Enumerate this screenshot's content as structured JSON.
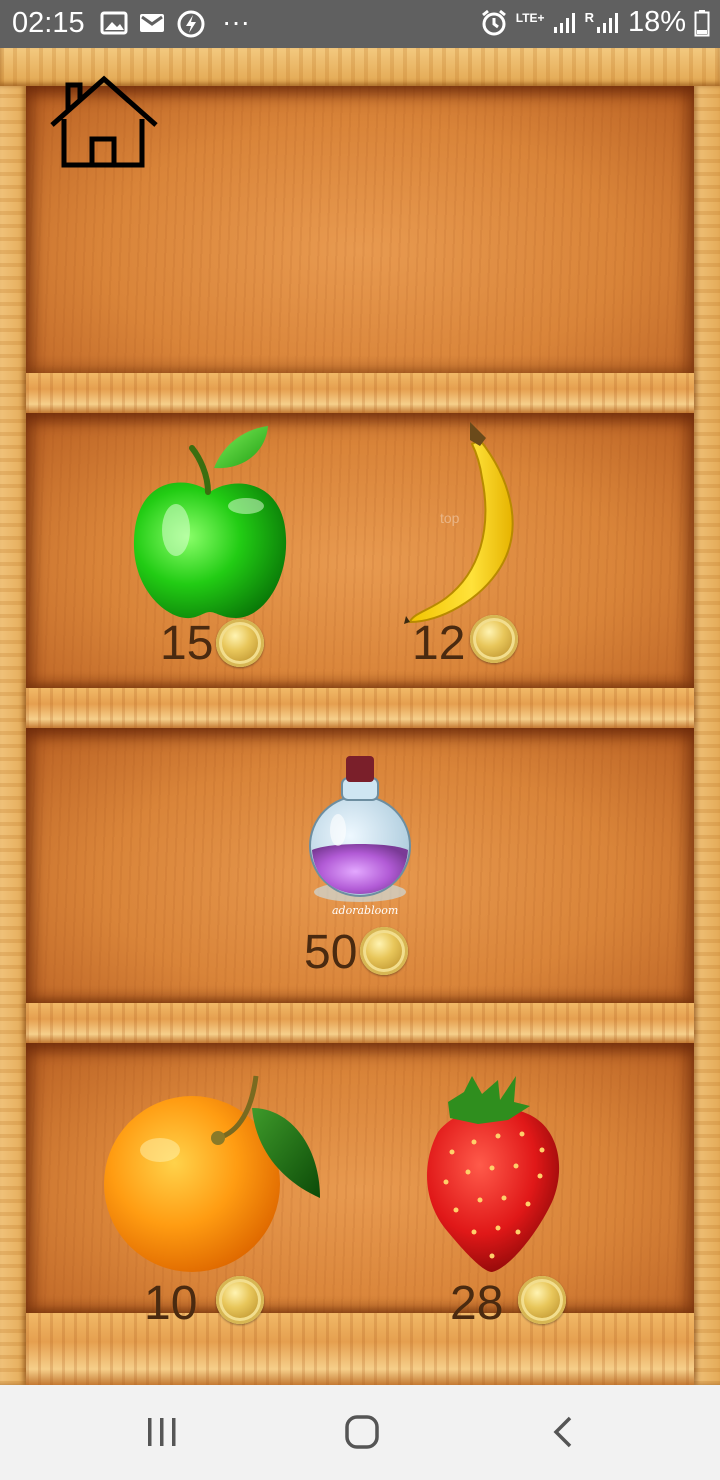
{
  "status_bar": {
    "time": "02:15",
    "network": "LTE+",
    "signal_label": "R",
    "battery": "18%",
    "overflow": "···",
    "left_icons": [
      "image-icon",
      "mail-icon",
      "lightning-icon"
    ],
    "right_icons": [
      "alarm-icon",
      "signal-icon",
      "battery-icon"
    ]
  },
  "shop": {
    "home_icon": "home-icon",
    "items": [
      {
        "name": "green apple",
        "icon": "green-apple-icon",
        "price": "15"
      },
      {
        "name": "banana",
        "icon": "banana-icon",
        "price": "12"
      },
      {
        "name": "potion",
        "icon": "potion-icon",
        "price": "50"
      },
      {
        "name": "orange",
        "icon": "orange-icon",
        "price": "10"
      },
      {
        "name": "strawberry",
        "icon": "strawberry-icon",
        "price": "28"
      }
    ],
    "potion_watermark": "adorabloom",
    "banana_watermark": "top"
  },
  "nav_bar": {
    "icons": [
      "recents-icon",
      "home-circle-icon",
      "back-icon"
    ]
  }
}
